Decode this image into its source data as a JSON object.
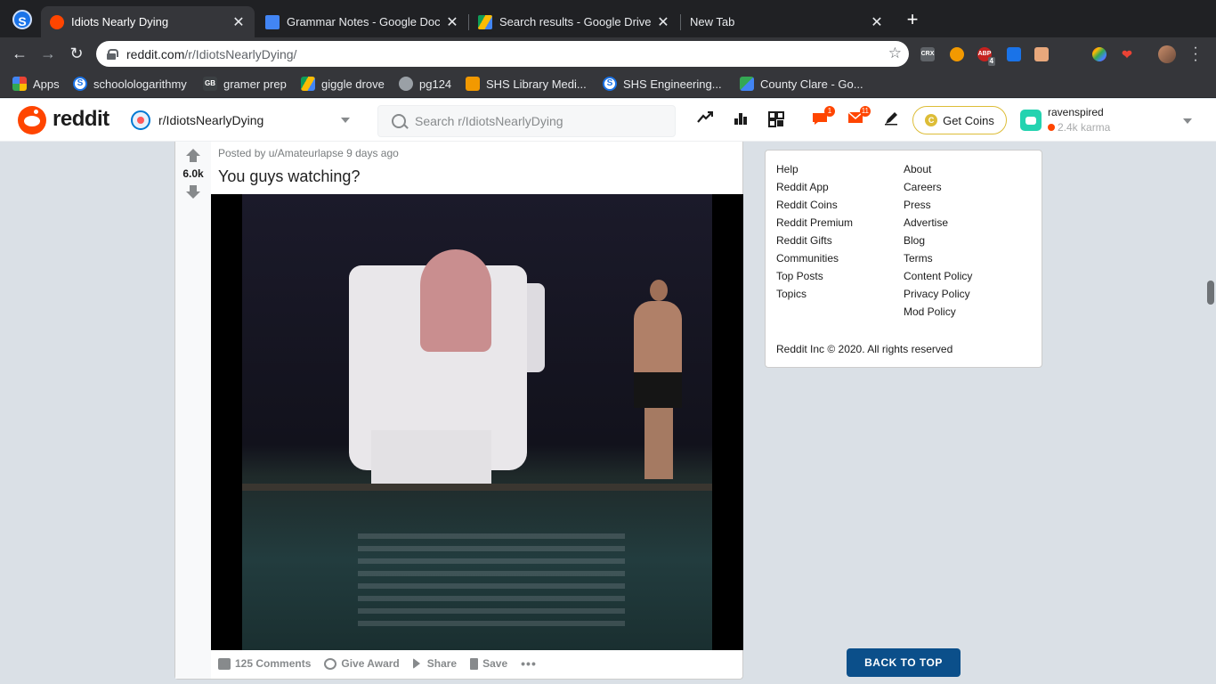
{
  "browser": {
    "tabs": [
      {
        "label": "Idiots Nearly Dying",
        "active": true,
        "favicon_color": "#ff4500"
      },
      {
        "label": "Grammar Notes - Google Docs",
        "active": false,
        "favicon_color": "#4285f4"
      },
      {
        "label": "Search results - Google Drive",
        "active": false,
        "favicon_color": "#fbbc04"
      },
      {
        "label": "New Tab",
        "active": false,
        "favicon_color": ""
      }
    ],
    "tab_close_glyph": "✕",
    "new_tab_glyph": "+",
    "url_domain": "reddit.com",
    "url_path": "/r/IdiotsNearlyDying/",
    "extensions": [
      {
        "name": "crx-icon",
        "text": "CRX",
        "color": "#5f6368"
      },
      {
        "name": "owl-extension-icon",
        "text": "",
        "color": "#f29900"
      },
      {
        "name": "adblock-icon",
        "text": "ABP",
        "color": "#c5221f"
      },
      {
        "name": "checklist-extension-icon",
        "text": "",
        "color": "#1a73e8"
      },
      {
        "name": "box-extension-icon",
        "text": "",
        "color": "#e8a87c"
      },
      {
        "name": "color-extension-icon",
        "text": "",
        "color": "#a142f4"
      },
      {
        "name": "heart-extension-icon",
        "text": "",
        "color": "#ea4335"
      }
    ],
    "adblock_badge": "4",
    "bookmarks": [
      {
        "label": "Apps",
        "icon": "apps-grid-icon",
        "color": "#ea4335"
      },
      {
        "label": "schoolologarithmy",
        "icon": "schoology-icon",
        "color": "#1a73e8"
      },
      {
        "label": "gramer prep",
        "icon": "gb-icon",
        "color": "#3c4043"
      },
      {
        "label": "giggle drove",
        "icon": "drive-icon",
        "color": "#34a853"
      },
      {
        "label": "pg124",
        "icon": "globe-icon",
        "color": "#9aa0a6"
      },
      {
        "label": "SHS Library Medi...",
        "icon": "library-icon",
        "color": "#f29900"
      },
      {
        "label": "SHS Engineering...",
        "icon": "schoology-icon",
        "color": "#1a73e8"
      },
      {
        "label": "County Clare - Go...",
        "icon": "maps-icon",
        "color": "#34a853"
      }
    ]
  },
  "reddit": {
    "wordmark": "reddit",
    "subreddit": "r/IdiotsNearlyDying",
    "search_placeholder": "Search r/IdiotsNearlyDying",
    "chat_badge": "1",
    "mail_badge": "11",
    "get_coins": "Get Coins",
    "coin_glyph": "C",
    "username": "ravenspired",
    "karma": "2.4k karma",
    "accent": "#ff4500",
    "coins_color": "#ddbd37"
  },
  "post": {
    "score": "6.0k",
    "posted_by": "Posted by u/Amateurlapse 9 days ago",
    "title": "You guys watching?",
    "actions": {
      "comments": "125 Comments",
      "award": "Give Award",
      "share": "Share",
      "save": "Save",
      "more": "•••"
    }
  },
  "footer": {
    "left_links": [
      "Help",
      "Reddit App",
      "Reddit Coins",
      "Reddit Premium",
      "Reddit Gifts",
      "Communities",
      "Top Posts",
      "Topics"
    ],
    "right_links": [
      "About",
      "Careers",
      "Press",
      "Advertise",
      "Blog",
      "Terms",
      "Content Policy",
      "Privacy Policy",
      "Mod Policy"
    ],
    "copyright": "Reddit Inc © 2020. All rights reserved",
    "back_to_top": "BACK TO TOP"
  }
}
